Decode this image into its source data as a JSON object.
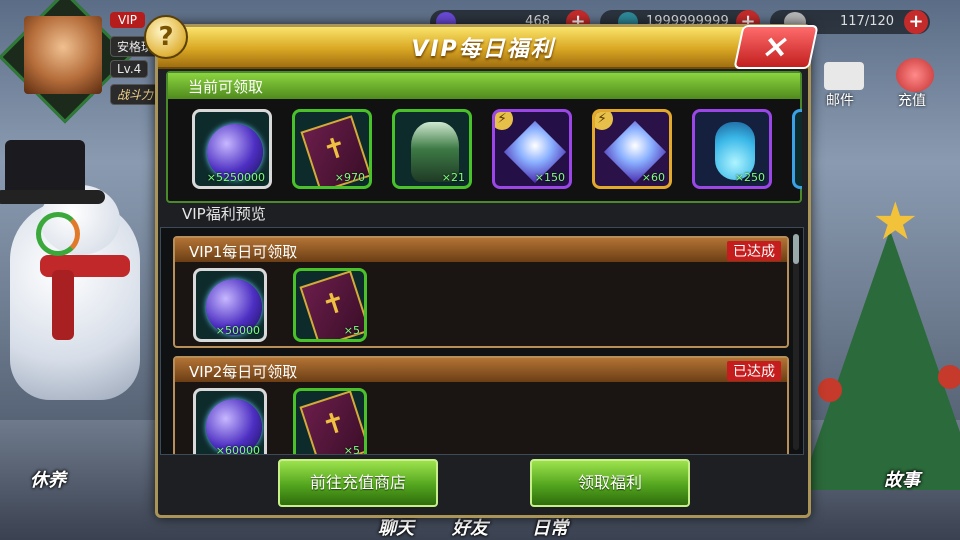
{
  "hud": {
    "vip": "VIP",
    "player_name": "安格琪",
    "level": "Lv.4",
    "power_label": "战斗力",
    "resource1": "468",
    "resource2": "1999999999",
    "stamina": "117/120",
    "plus": "+"
  },
  "side_icons": {
    "mail": "邮件",
    "recharge": "充值"
  },
  "side_labels": {
    "left": "休养",
    "right": "故事"
  },
  "bottom_tabs": [
    "聊天",
    "好友",
    "日常"
  ],
  "dialog": {
    "title": "VIP每日福利",
    "help": "?",
    "close": "×",
    "current_header": "当前可领取",
    "current_items": [
      {
        "icon": "orb",
        "rarity": "white",
        "qty": "×5250000"
      },
      {
        "icon": "card",
        "rarity": "green",
        "qty": "×970"
      },
      {
        "icon": "character",
        "rarity": "green",
        "qty": "×21"
      },
      {
        "icon": "crystal",
        "rarity": "purple",
        "qty": "×150",
        "badge": true
      },
      {
        "icon": "crystal",
        "rarity": "gold",
        "qty": "×60",
        "badge": true
      },
      {
        "icon": "potion",
        "rarity": "purple",
        "qty": "×250"
      }
    ],
    "preview_label": "VIP福利预览",
    "tiers": [
      {
        "title": "VIP1每日可领取",
        "status": "已达成",
        "items": [
          {
            "icon": "orb",
            "rarity": "white",
            "qty": "×50000"
          },
          {
            "icon": "card",
            "rarity": "green",
            "qty": "×5"
          }
        ]
      },
      {
        "title": "VIP2每日可领取",
        "status": "已达成",
        "items": [
          {
            "icon": "orb",
            "rarity": "white",
            "qty": "×60000"
          },
          {
            "icon": "card",
            "rarity": "green",
            "qty": "×5"
          }
        ]
      }
    ],
    "btn_shop": "前往充值商店",
    "btn_claim": "领取福利"
  }
}
